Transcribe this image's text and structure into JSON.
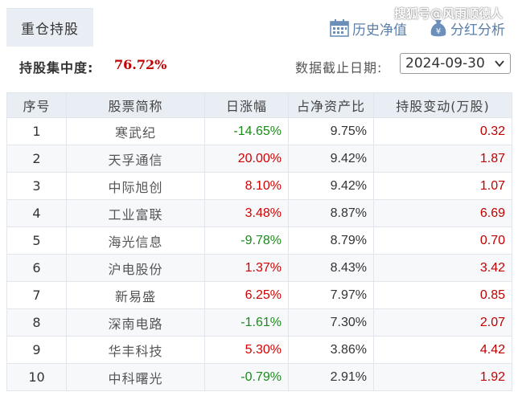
{
  "tabs": {
    "active_label": "重仓持股"
  },
  "watermark": "搜狐号@风雨顺德人",
  "toolbar": {
    "history_label": "历史净值",
    "dividend_label": "分红分析",
    "history_icon": "calendar-icon",
    "dividend_icon": "money-bag-icon"
  },
  "summary": {
    "concentration_label": "持股集中度:",
    "concentration_value": "76.72%",
    "deadline_label": "数据截止日期:",
    "deadline_value": "2024-09-30"
  },
  "colors": {
    "up": "#d40000",
    "down": "#1a8a1a",
    "header_bg": "#e9eef5",
    "link": "#5a7fa8"
  },
  "table": {
    "headers": [
      "序号",
      "股票简称",
      "日涨幅",
      "占净资产比",
      "持股变动(万股)"
    ],
    "rows": [
      {
        "idx": "1",
        "name": "寒武纪",
        "change": "-14.65%",
        "dir": "down",
        "ratio": "9.75%",
        "holding": "0.32"
      },
      {
        "idx": "2",
        "name": "天孚通信",
        "change": "20.00%",
        "dir": "up",
        "ratio": "9.42%",
        "holding": "1.87"
      },
      {
        "idx": "3",
        "name": "中际旭创",
        "change": "8.10%",
        "dir": "up",
        "ratio": "9.42%",
        "holding": "1.07"
      },
      {
        "idx": "4",
        "name": "工业富联",
        "change": "3.48%",
        "dir": "up",
        "ratio": "8.87%",
        "holding": "6.69"
      },
      {
        "idx": "5",
        "name": "海光信息",
        "change": "-9.78%",
        "dir": "down",
        "ratio": "8.79%",
        "holding": "0.70"
      },
      {
        "idx": "6",
        "name": "沪电股份",
        "change": "1.37%",
        "dir": "up",
        "ratio": "8.43%",
        "holding": "3.42"
      },
      {
        "idx": "7",
        "name": "新易盛",
        "change": "6.25%",
        "dir": "up",
        "ratio": "7.97%",
        "holding": "0.85"
      },
      {
        "idx": "8",
        "name": "深南电路",
        "change": "-1.61%",
        "dir": "down",
        "ratio": "7.30%",
        "holding": "2.07"
      },
      {
        "idx": "9",
        "name": "华丰科技",
        "change": "5.30%",
        "dir": "up",
        "ratio": "3.86%",
        "holding": "4.42"
      },
      {
        "idx": "10",
        "name": "中科曙光",
        "change": "-0.79%",
        "dir": "down",
        "ratio": "2.91%",
        "holding": "1.92"
      }
    ]
  }
}
